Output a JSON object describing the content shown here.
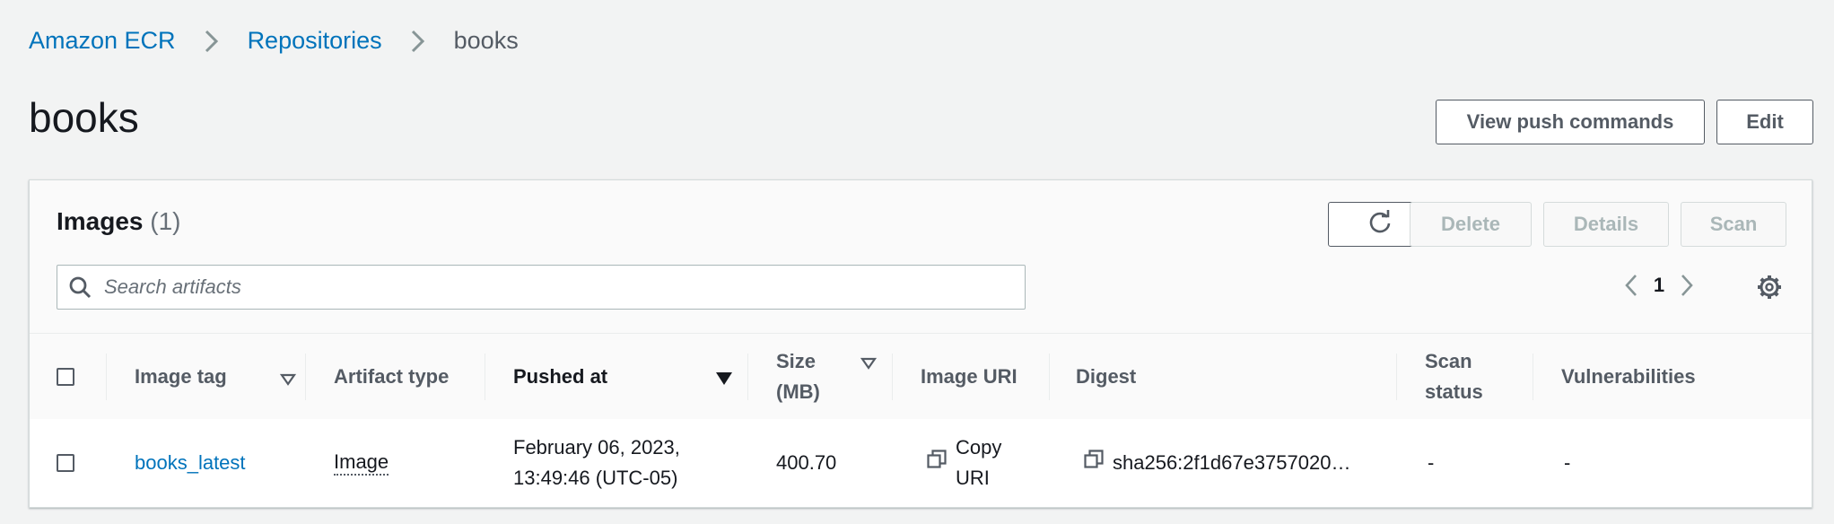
{
  "breadcrumb": {
    "items": [
      "Amazon ECR",
      "Repositories"
    ],
    "current": "books"
  },
  "page": {
    "title": "books",
    "view_push_commands_label": "View push commands",
    "edit_label": "Edit"
  },
  "images_panel": {
    "title": "Images",
    "count": "(1)",
    "actions": {
      "delete_label": "Delete",
      "details_label": "Details",
      "scan_label": "Scan"
    },
    "search": {
      "placeholder": "Search artifacts",
      "value": ""
    },
    "pagination": {
      "current_page": "1"
    },
    "columns": {
      "image_tag": "Image tag",
      "artifact_type": "Artifact type",
      "pushed_at": "Pushed at",
      "size_line1": "Size",
      "size_line2": "(MB)",
      "image_uri": "Image URI",
      "digest": "Digest",
      "scan_status_line1": "Scan",
      "scan_status_line2": "status",
      "vulnerabilities": "Vulnerabilities"
    },
    "rows": [
      {
        "image_tag": "books_latest",
        "artifact_type": "Image",
        "pushed_at_line1": "February 06, 2023,",
        "pushed_at_line2": "13:49:46 (UTC-05)",
        "size": "400.70",
        "copy_uri_line1": "Copy",
        "copy_uri_line2": "URI",
        "digest": "sha256:2f1d67e3757020…",
        "scan_status": "-",
        "vulnerabilities": "-"
      }
    ]
  },
  "colors": {
    "link": "#0073bb",
    "background": "#f2f3f3",
    "text": "#16191f",
    "secondary_text": "#545b64"
  }
}
